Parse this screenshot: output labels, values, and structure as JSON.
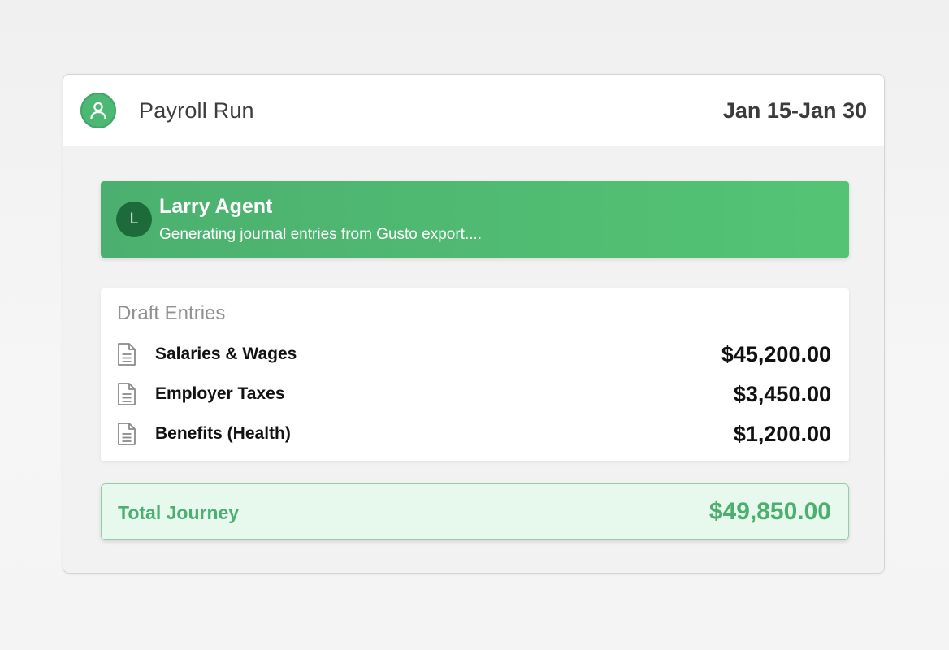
{
  "header": {
    "avatar_icon": "user-icon",
    "title": "Payroll Run",
    "date_range": "Jan 15-Jan 30"
  },
  "agent": {
    "initial": "L",
    "name": "Larry Agent",
    "status": "Generating journal entries from Gusto export....",
    "color": "#4bb06f"
  },
  "draft_entries": {
    "title": "Draft Entries",
    "items": [
      {
        "icon": "document-icon",
        "label": "Salaries & Wages",
        "amount": "$45,200.00"
      },
      {
        "icon": "document-icon",
        "label": "Employer Taxes",
        "amount": "$3,450.00"
      },
      {
        "icon": "document-icon",
        "label": "Benefits (Health)",
        "amount": "$1,200.00"
      }
    ]
  },
  "total": {
    "label": "Total Journey",
    "amount": "$49,850.00",
    "color": "#4cae6f"
  }
}
